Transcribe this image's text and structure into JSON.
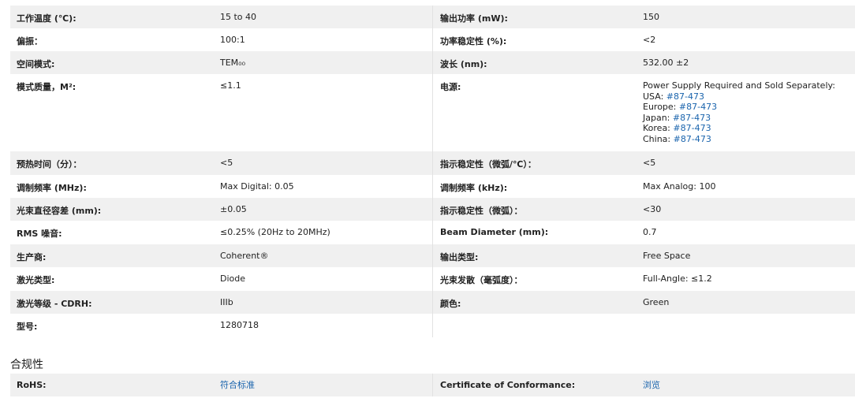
{
  "specs": [
    {
      "l1": "工作温度 (℃):",
      "v1": "15 to 40",
      "l2": "输出功率 (mW):",
      "v2": "150"
    },
    {
      "l1": "偏振：",
      "v1": "100:1",
      "l2": "功率稳定性 (%):",
      "v2": "<2"
    },
    {
      "l1": "空间模式:",
      "v1": "TEM₀₀",
      "l2": "波长 (nm):",
      "v2": "532.00 ±2"
    },
    {
      "l1": "模式质量，M²:",
      "v1": "≤1.1",
      "l2": "电源:",
      "power": {
        "intro": "Power Supply Required and Sold Separately:",
        "items": [
          {
            "region": "USA:",
            "part": "#87-473"
          },
          {
            "region": "Europe:",
            "part": "#87-473"
          },
          {
            "region": "Japan:",
            "part": "#87-473"
          },
          {
            "region": "Korea:",
            "part": "#87-473"
          },
          {
            "region": "China:",
            "part": "#87-473"
          }
        ]
      }
    },
    {
      "l1": "预热时间（分）：",
      "v1": "<5",
      "l2": "指示稳定性（微弧/℃）：",
      "v2": "<5"
    },
    {
      "l1": "调制频率 (MHz):",
      "v1": "Max Digital: 0.05",
      "l2": "调制频率 (kHz):",
      "v2": "Max Analog: 100"
    },
    {
      "l1": "光束直径容差 (mm):",
      "v1": "±0.05",
      "l2": "指示稳定性（微弧）：",
      "v2": "<30"
    },
    {
      "l1": "RMS 噪音:",
      "v1": "≤0.25% (20Hz to 20MHz)",
      "l2": "Beam Diameter (mm):",
      "v2": "0.7"
    },
    {
      "l1": "生产商:",
      "v1": "Coherent®",
      "l2": "输出类型:",
      "v2": "Free Space"
    },
    {
      "l1": "激光类型:",
      "v1": "Diode",
      "l2": "光束发散（毫弧度）：",
      "v2": "Full-Angle: ≤1.2"
    },
    {
      "l1": "激光等级 - CDRH:",
      "v1": "IIIb",
      "l2": "颜色:",
      "v2": "Green"
    },
    {
      "l1": "型号:",
      "v1": "1280718",
      "l2": "",
      "v2": ""
    }
  ],
  "compliance": {
    "title": "合规性",
    "rohs_label": "RoHS:",
    "rohs_link": "符合标准",
    "cert_label": "Certificate of Conformance:",
    "cert_link": "浏览"
  },
  "colors": {
    "link": "#1a64ad",
    "shade": "#f0f0f0"
  }
}
